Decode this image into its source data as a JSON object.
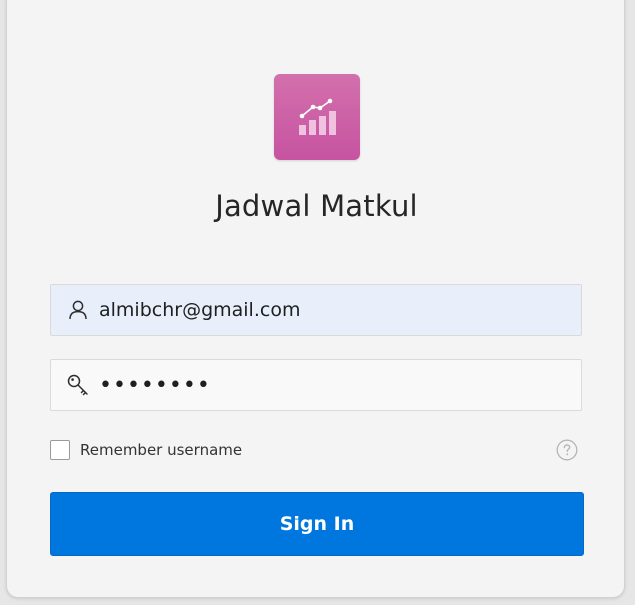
{
  "app": {
    "title": "Jadwal Matkul",
    "logo_icon": "chart-growth-icon",
    "logo_color": "#cc5ea6"
  },
  "form": {
    "username": {
      "icon": "user-icon",
      "value": "almibchr@gmail.com"
    },
    "password": {
      "icon": "key-icon",
      "value": "password"
    },
    "remember": {
      "label": "Remember username",
      "checked": false
    },
    "help_icon": "help-icon",
    "submit_label": "Sign In",
    "submit_color": "#0076df"
  }
}
